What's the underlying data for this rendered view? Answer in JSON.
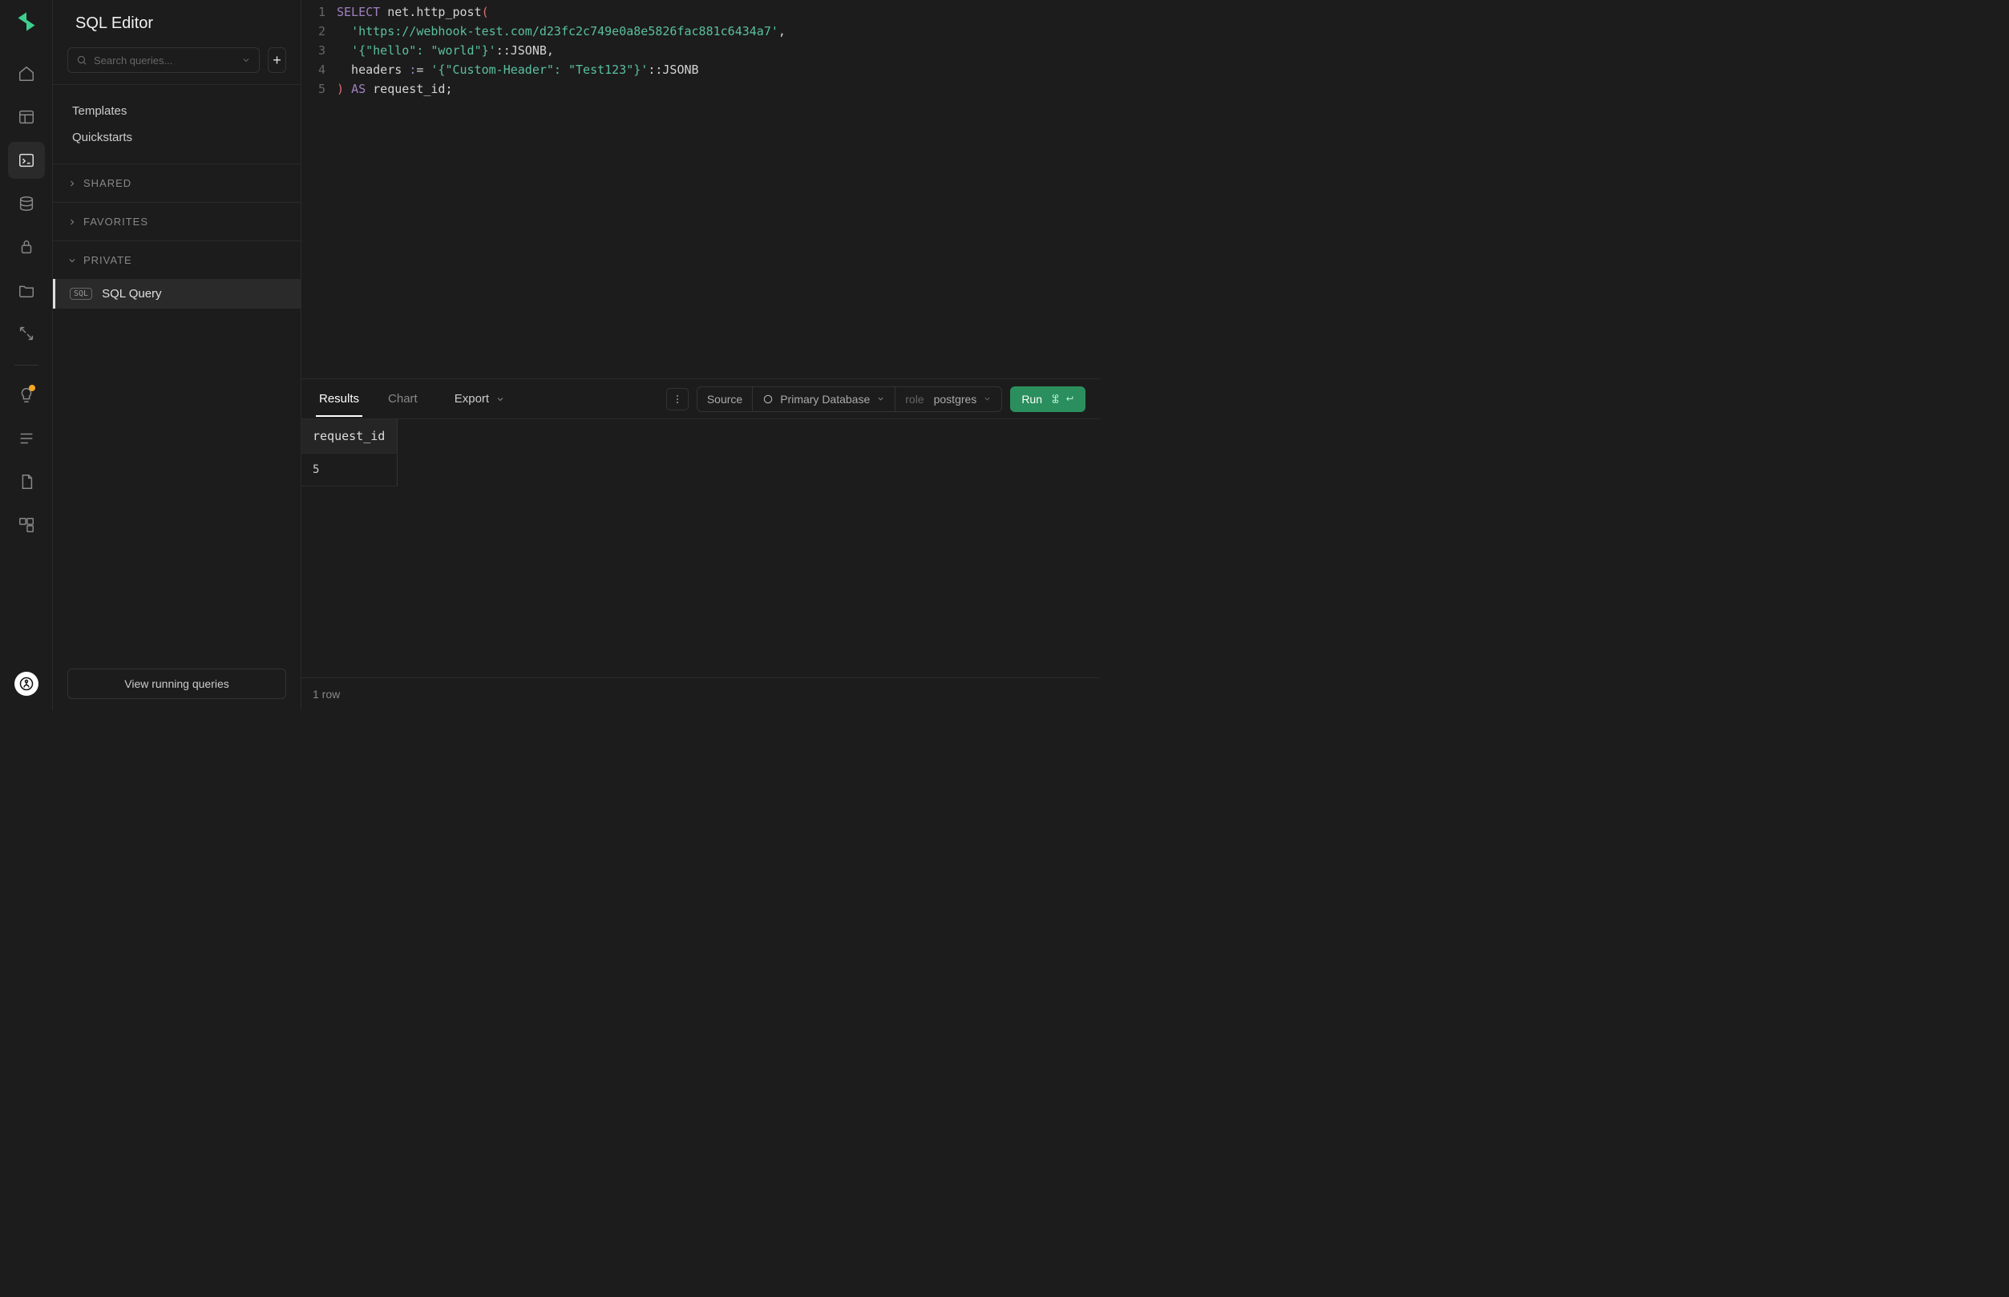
{
  "app": {
    "title": "SQL Editor"
  },
  "sidebar": {
    "search_placeholder": "Search queries...",
    "links": {
      "templates": "Templates",
      "quickstarts": "Quickstarts"
    },
    "sections": {
      "shared": "SHARED",
      "favorites": "FAVORITES",
      "private": "PRIVATE"
    },
    "private_items": [
      {
        "badge": "SQL",
        "label": "SQL Query"
      }
    ],
    "footer_button": "View running queries"
  },
  "editor": {
    "lines": [
      {
        "n": "1",
        "segments": [
          {
            "t": "SELECT ",
            "c": "kw"
          },
          {
            "t": "net.http_post",
            "c": "id"
          },
          {
            "t": "(",
            "c": "paren"
          }
        ]
      },
      {
        "n": "2",
        "segments": [
          {
            "t": "  ",
            "c": ""
          },
          {
            "t": "'https://webhook-test.com/d23fc2c749e0a8e5826fac881c6434a7'",
            "c": "str"
          },
          {
            "t": ",",
            "c": "op"
          }
        ]
      },
      {
        "n": "3",
        "segments": [
          {
            "t": "  ",
            "c": ""
          },
          {
            "t": "'{\"hello\": \"world\"}'",
            "c": "str"
          },
          {
            "t": "::JSONB,",
            "c": "cast"
          }
        ]
      },
      {
        "n": "4",
        "segments": [
          {
            "t": "  headers ",
            "c": "id"
          },
          {
            "t": ":",
            "c": "kw"
          },
          {
            "t": "= ",
            "c": "op"
          },
          {
            "t": "'{\"Custom-Header\": \"Test123\"}'",
            "c": "str"
          },
          {
            "t": "::JSONB",
            "c": "cast"
          }
        ]
      },
      {
        "n": "5",
        "segments": [
          {
            "t": ")",
            "c": "paren"
          },
          {
            "t": " ",
            "c": ""
          },
          {
            "t": "AS",
            "c": "kw"
          },
          {
            "t": " request_id;",
            "c": "id"
          }
        ]
      }
    ]
  },
  "results_bar": {
    "tabs": {
      "results": "Results",
      "chart": "Chart"
    },
    "export": "Export",
    "source_label": "Source",
    "primary_db": "Primary Database",
    "role_label": "role",
    "role_value": "postgres",
    "run_label": "Run"
  },
  "results": {
    "columns": [
      "request_id"
    ],
    "rows": [
      [
        "5"
      ]
    ],
    "row_count_label": "1 row"
  }
}
